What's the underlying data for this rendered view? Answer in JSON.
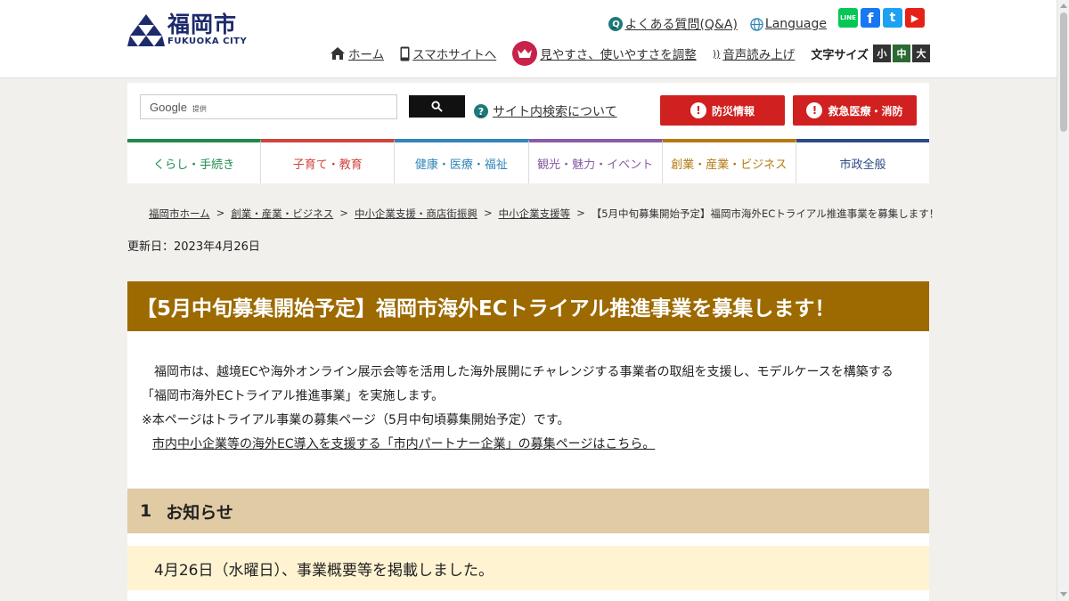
{
  "logo": {
    "title": "福岡市",
    "subtitle": "FUKUOKA CITY"
  },
  "top_links": [
    {
      "label": "よくある質問(Q&A)"
    },
    {
      "label": "Language"
    }
  ],
  "social": {
    "line": "LINE",
    "facebook": "f",
    "twitter": "t",
    "youtube": "▶"
  },
  "util_nav": {
    "home": "ホーム",
    "mobile": "スマホサイトへ",
    "accessibility": "見やすさ、使いやすさを調整",
    "read_aloud": "音声読み上げ",
    "font_size_label": "文字サイズ",
    "font_small": "小",
    "font_medium": "中",
    "font_large": "大"
  },
  "search": {
    "provider": "Google",
    "provided_by": "提供",
    "about": "サイト内検索について"
  },
  "alerts": {
    "disaster": "防災情報",
    "emergency": "救急医療・消防"
  },
  "gnav": [
    {
      "label": "くらし・手続き",
      "color": "#1f8a4c"
    },
    {
      "label": "子育て・教育",
      "color": "#d0443e"
    },
    {
      "label": "健康・医療・福祉",
      "color": "#2f86b9"
    },
    {
      "label": "観光・魅力・イベント",
      "color": "#8b5aa6"
    },
    {
      "label": "創業・産業・ビジネス",
      "color": "#b57a12"
    },
    {
      "label": "市政全般",
      "color": "#2c4a85"
    }
  ],
  "breadcrumb": {
    "items": [
      "福岡市ホーム",
      "創業・産業・ビジネス",
      "中小企業支援・商店街振興",
      "中小企業支援等"
    ],
    "current": "【5月中旬募集開始予定】福岡市海外ECトライアル推進事業を募集します！",
    "sep": ">"
  },
  "updated": "更新日：2023年4月26日",
  "page_title": "【5月中旬募集開始予定】福岡市海外ECトライアル推進事業を募集します！",
  "intro": {
    "line1": "福岡市は、越境ECや海外オンライン展示会等を活用した海外展開にチャレンジする事業者の取組を支援し、モデルケースを構築する",
    "line2": "「福岡市海外ECトライアル推進事業」を実施します。",
    "line3": "※本ページはトライアル事業の募集ページ（5月中旬頃募集開始予定）です。",
    "link": "市内中小企業等の海外EC導入を支援する「市内パートナー企業」の募集ページはこちら。"
  },
  "section1": {
    "num": "1",
    "title": "お知らせ"
  },
  "notice": "4月26日（水曜日）、事業概要等を掲載しました。"
}
